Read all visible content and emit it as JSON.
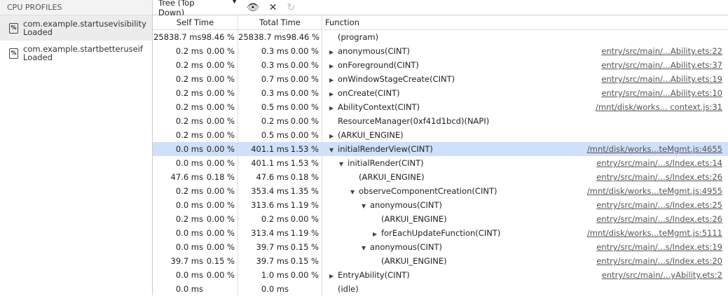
{
  "sidebar": {
    "title": "CPU PROFILES",
    "profiles": [
      {
        "name": "com.example.startusevisibility",
        "status": "Loaded",
        "selected": true
      },
      {
        "name": "com.example.startbetteruseif",
        "status": "Loaded",
        "selected": false
      }
    ]
  },
  "toolbar": {
    "view": "Tree (Top Down)"
  },
  "columns": {
    "self": "Self Time",
    "total": "Total Time",
    "function": "Function"
  },
  "rows": [
    [
      "25838.7 ms",
      "98.46 %",
      "25838.7 ms",
      "98.46 %",
      0,
      "",
      "(program)",
      ""
    ],
    [
      "0.2 ms",
      "0.00 %",
      "0.3 ms",
      "0.00 %",
      0,
      "▶",
      "anonymous(CINT)",
      "entry/src/main/...Ability.ets:22"
    ],
    [
      "0.2 ms",
      "0.00 %",
      "0.3 ms",
      "0.00 %",
      0,
      "▶",
      "onForeground(CINT)",
      "entry/src/main/...Ability.ets:37"
    ],
    [
      "0.2 ms",
      "0.00 %",
      "0.7 ms",
      "0.00 %",
      0,
      "▶",
      "onWindowStageCreate(CINT)",
      "entry/src/main/...Ability.ets:19"
    ],
    [
      "0.2 ms",
      "0.00 %",
      "0.3 ms",
      "0.00 %",
      0,
      "▶",
      "onCreate(CINT)",
      "entry/src/main/...Ability.ets:10"
    ],
    [
      "0.2 ms",
      "0.00 %",
      "0.5 ms",
      "0.00 %",
      0,
      "▶",
      "AbilityContext(CINT)",
      "/mnt/disk/works... context.js:31"
    ],
    [
      "0.2 ms",
      "0.00 %",
      "0.2 ms",
      "0.00 %",
      0,
      "",
      "ResourceManager(0xf41d1bcd)(NAPI)",
      ""
    ],
    [
      "0.2 ms",
      "0.00 %",
      "0.5 ms",
      "0.00 %",
      0,
      "▶",
      "(ARKUI_ENGINE)",
      ""
    ],
    [
      "0.0 ms",
      "0.00 %",
      "401.1 ms",
      "1.53 %",
      0,
      "▼",
      "initialRenderView(CINT)",
      "/mnt/disk/works...teMgmt.js:4655"
    ],
    [
      "0.0 ms",
      "0.00 %",
      "401.1 ms",
      "1.53 %",
      1,
      "▼",
      "initialRender(CINT)",
      "entry/src/main/...s/Index.ets:14"
    ],
    [
      "47.6 ms",
      "0.18 %",
      "47.6 ms",
      "0.18 %",
      2,
      "",
      "(ARKUI_ENGINE)",
      "entry/src/main/...s/Index.ets:26"
    ],
    [
      "0.2 ms",
      "0.00 %",
      "353.4 ms",
      "1.35 %",
      2,
      "▼",
      "observeComponentCreation(CINT)",
      "/mnt/disk/works...teMgmt.js:4955"
    ],
    [
      "0.0 ms",
      "0.00 %",
      "313.6 ms",
      "1.19 %",
      3,
      "▼",
      "anonymous(CINT)",
      "entry/src/main/...s/Index.ets:25"
    ],
    [
      "0.2 ms",
      "0.00 %",
      "0.2 ms",
      "0.00 %",
      4,
      "",
      "(ARKUI_ENGINE)",
      "entry/src/main/...s/Index.ets:26"
    ],
    [
      "0.0 ms",
      "0.00 %",
      "313.4 ms",
      "1.19 %",
      4,
      "▶",
      "forEachUpdateFunction(CINT)",
      "/mnt/disk/works...teMgmt.js:5111"
    ],
    [
      "0.0 ms",
      "0.00 %",
      "39.7 ms",
      "0.15 %",
      3,
      "▼",
      "anonymous(CINT)",
      "entry/src/main/...s/Index.ets:19"
    ],
    [
      "39.7 ms",
      "0.15 %",
      "39.7 ms",
      "0.15 %",
      4,
      "",
      "(ARKUI_ENGINE)",
      "entry/src/main/...s/Index.ets:20"
    ],
    [
      "0.0 ms",
      "0.00 %",
      "1.0 ms",
      "0.00 %",
      0,
      "▶",
      "EntryAbility(CINT)",
      "entry/src/main/...yAbility.ets:2"
    ],
    [
      "0.0 ms",
      "",
      "0.0 ms",
      "",
      0,
      "",
      "(idle)",
      ""
    ]
  ],
  "selected_row": 8
}
